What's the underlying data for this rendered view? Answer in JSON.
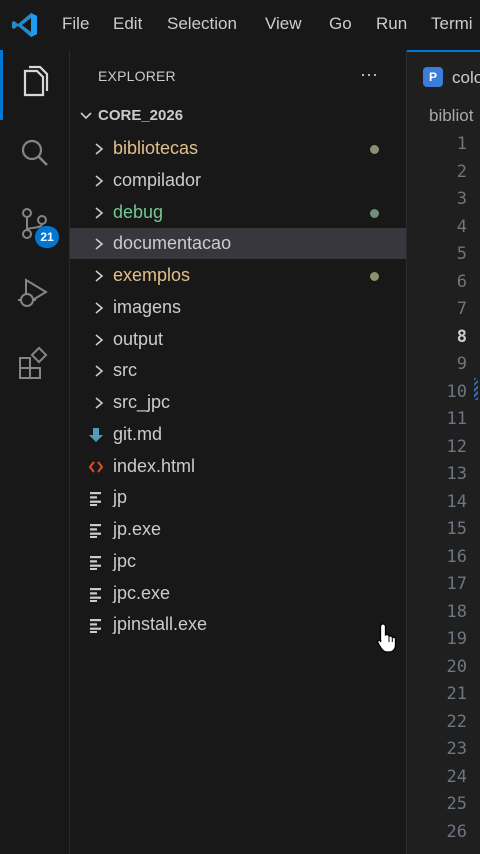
{
  "menu": [
    "File",
    "Edit",
    "Selection",
    "View",
    "Go",
    "Run",
    "Termi"
  ],
  "activity_bar": {
    "items": [
      "explorer-icon",
      "search-icon",
      "source-control-icon",
      "run-debug-icon",
      "extensions-icon"
    ],
    "source_control_badge": "21",
    "accent_color": "#0078d4"
  },
  "sidebar": {
    "title": "EXPLORER",
    "more_actions": "···",
    "root": "CORE_2026",
    "items": [
      {
        "label": "bibliotecas",
        "kind": "folder",
        "color": "#e2c08d",
        "dot": "#8f8f6f"
      },
      {
        "label": "compilador",
        "kind": "folder",
        "color": "#cccccc"
      },
      {
        "label": "debug",
        "kind": "folder",
        "color": "#73c991",
        "dot": "#6b8f7a"
      },
      {
        "label": "documentacao",
        "kind": "folder",
        "color": "#cccccc",
        "selected": true
      },
      {
        "label": "exemplos",
        "kind": "folder",
        "color": "#e2c08d",
        "dot": "#8f8f6f"
      },
      {
        "label": "imagens",
        "kind": "folder",
        "color": "#cccccc"
      },
      {
        "label": "output",
        "kind": "folder",
        "color": "#cccccc"
      },
      {
        "label": "src",
        "kind": "folder",
        "color": "#cccccc"
      },
      {
        "label": "src_jpc",
        "kind": "folder",
        "color": "#cccccc"
      },
      {
        "label": "git.md",
        "kind": "markdown",
        "color": "#cccccc"
      },
      {
        "label": "index.html",
        "kind": "html",
        "color": "#cccccc"
      },
      {
        "label": "jp",
        "kind": "file",
        "color": "#cccccc"
      },
      {
        "label": "jp.exe",
        "kind": "file",
        "color": "#cccccc"
      },
      {
        "label": "jpc",
        "kind": "file",
        "color": "#cccccc"
      },
      {
        "label": "jpc.exe",
        "kind": "file",
        "color": "#cccccc"
      },
      {
        "label": "jpinstall.exe",
        "kind": "file",
        "color": "#cccccc"
      }
    ]
  },
  "editor": {
    "tab_label": "colo",
    "breadcrumb": "bibliot",
    "line_numbers": [
      "1",
      "2",
      "3",
      "4",
      "5",
      "6",
      "7",
      "8",
      "9",
      "10",
      "11",
      "12",
      "13",
      "14",
      "15",
      "16",
      "17",
      "18",
      "19",
      "20",
      "21",
      "22",
      "23",
      "24",
      "25",
      "26"
    ],
    "current_line": "8"
  }
}
